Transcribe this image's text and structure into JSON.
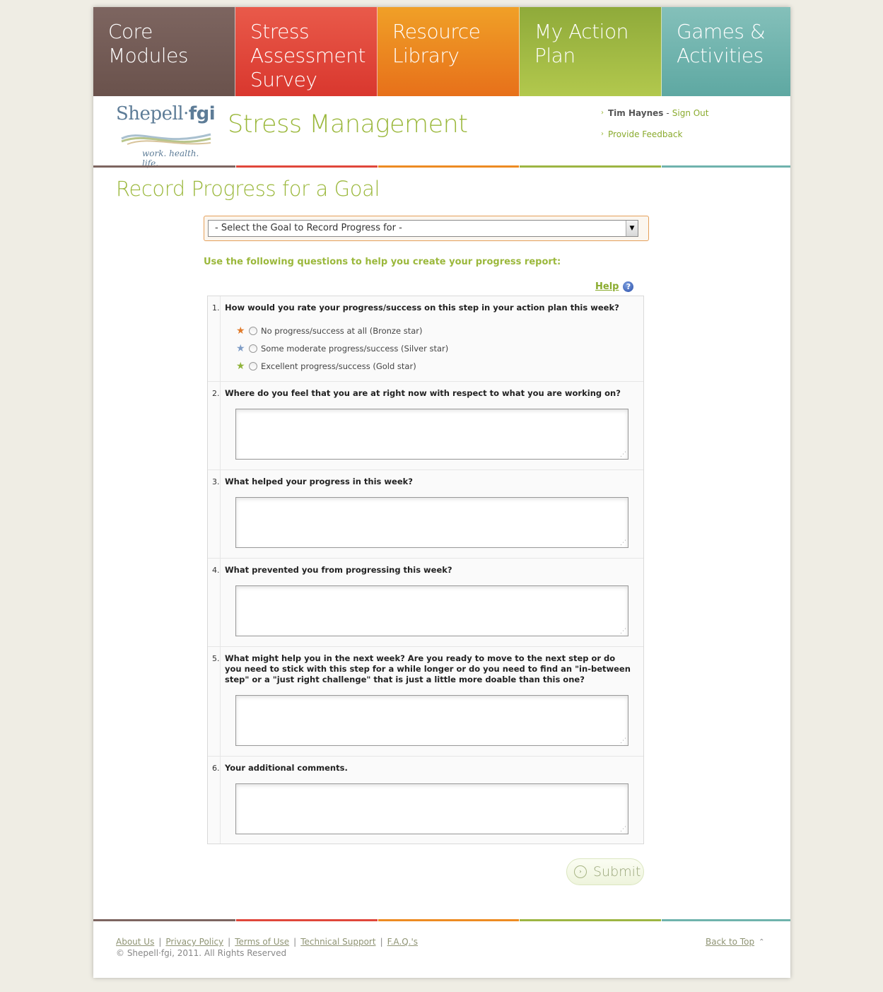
{
  "nav": {
    "tabs": [
      {
        "lines": [
          "Core Modules"
        ]
      },
      {
        "lines": [
          "Stress",
          "Assessment",
          "Survey"
        ]
      },
      {
        "lines": [
          "Resource",
          "Library"
        ]
      },
      {
        "lines": [
          "My Action",
          "Plan"
        ]
      },
      {
        "lines": [
          "Games &",
          "Activities"
        ]
      }
    ]
  },
  "header": {
    "logo_name": "Shepell",
    "logo_suffix": "fgi",
    "logo_dot": "·",
    "logo_tagline": "work. health. life.",
    "site_title": "Stress Management",
    "user_name": "Tim Haynes",
    "separator": "-",
    "sign_out": "Sign Out",
    "feedback": "Provide Feedback"
  },
  "main": {
    "page_title": "Record Progress for a Goal",
    "goal_select_value": "- Select the Goal to Record Progress for -",
    "instructions": "Use the following questions to help you create your progress report:",
    "help_label": "Help",
    "questions": [
      {
        "num": "1.",
        "text": "How would you rate your progress/success on this step in your action plan this week?"
      },
      {
        "num": "2.",
        "text": "Where do you feel that you are at right now with respect to what you are working on?"
      },
      {
        "num": "3.",
        "text": "What helped your progress in this week?"
      },
      {
        "num": "4.",
        "text": "What prevented you from progressing this week?"
      },
      {
        "num": "5.",
        "text": "What might help you in the next week? Are you ready to move to the next step or do you need to stick with this step for a while longer or do you need to find an \"in-between step\" or a \"just right challenge\" that is just a little more doable than this one?"
      },
      {
        "num": "6.",
        "text": "Your additional comments."
      }
    ],
    "rating_options": [
      {
        "label": "No progress/success at all (Bronze star)",
        "color": "#e07a2a"
      },
      {
        "label": "Some moderate progress/success (Silver star)",
        "color": "#7e9cc6"
      },
      {
        "label": "Excellent progress/success (Gold star)",
        "color": "#8fb33a"
      }
    ],
    "submit_label": "Submit"
  },
  "footer": {
    "links": [
      "About Us",
      "Privacy Policy",
      "Terms of Use",
      "Technical Support",
      "F.A.Q.'s"
    ],
    "separator": "|",
    "copyright": "© Shepell·fgi, 2011. All Rights Reserved",
    "back_to_top": "Back to Top"
  },
  "colors": {
    "accent_green": "#9bb83c",
    "tab_brown": "#7d6560",
    "tab_red": "#e0473b",
    "tab_orange": "#ed8b22",
    "tab_green": "#9db543",
    "tab_teal": "#6fb3ad"
  }
}
